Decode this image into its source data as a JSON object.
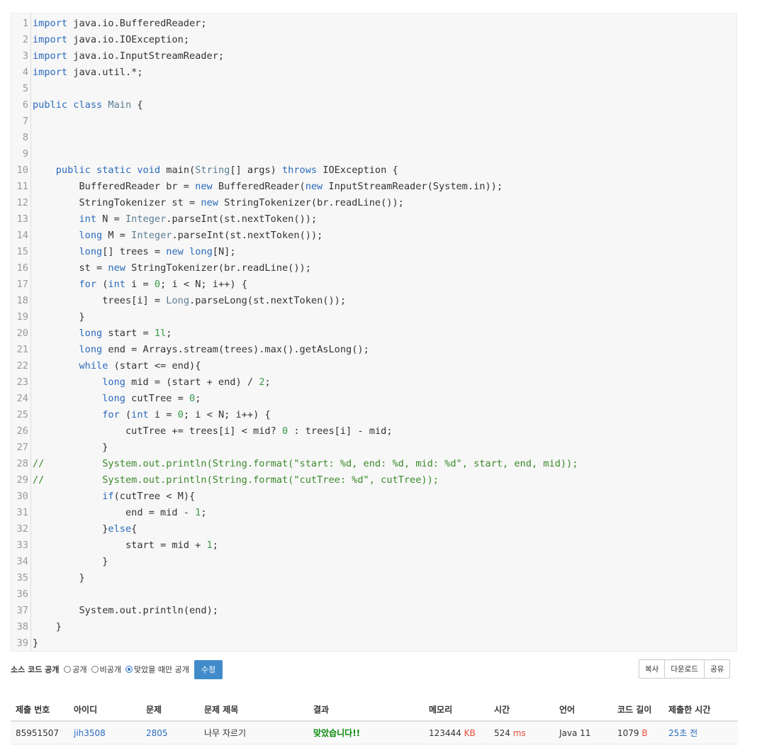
{
  "code": {
    "lines": [
      "import java.io.BufferedReader;",
      "import java.io.IOException;",
      "import java.io.InputStreamReader;",
      "import java.util.*;",
      "",
      "public class Main {",
      "",
      "",
      "",
      "    public static void main(String[] args) throws IOException {",
      "        BufferedReader br = new BufferedReader(new InputStreamReader(System.in));",
      "        StringTokenizer st = new StringTokenizer(br.readLine());",
      "        int N = Integer.parseInt(st.nextToken());",
      "        long M = Integer.parseInt(st.nextToken());",
      "        long[] trees = new long[N];",
      "        st = new StringTokenizer(br.readLine());",
      "        for (int i = 0; i < N; i++) {",
      "            trees[i] = Long.parseLong(st.nextToken());",
      "        }",
      "        long start = 1l;",
      "        long end = Arrays.stream(trees).max().getAsLong();",
      "        while (start <= end){",
      "            long mid = (start + end) / 2;",
      "            long cutTree = 0;",
      "            for (int i = 0; i < N; i++) {",
      "                cutTree += trees[i] < mid? 0 : trees[i] - mid;",
      "            }",
      "//          System.out.println(String.format(\"start: %d, end: %d, mid: %d\", start, end, mid));",
      "//          System.out.println(String.format(\"cutTree: %d\", cutTree));",
      "            if(cutTree < M){",
      "                end = mid - 1;",
      "            }else{",
      "                start = mid + 1;",
      "            }",
      "        }",
      "",
      "        System.out.println(end);",
      "    }",
      "}"
    ]
  },
  "source_visibility": {
    "label": "소스 코드 공개",
    "options": [
      "공개",
      "비공개",
      "맞았을 때만 공개"
    ],
    "selected_index": 2,
    "edit_label": "수정"
  },
  "actions": {
    "copy": "복사",
    "download": "다운로드",
    "share": "공유"
  },
  "table": {
    "headers": [
      "제출 번호",
      "아이디",
      "문제",
      "문제 제목",
      "결과",
      "메모리",
      "시간",
      "언어",
      "코드 길이",
      "제출한 시간"
    ],
    "row": {
      "submission_id": "85951507",
      "user_id": "jih3508",
      "problem_id": "2805",
      "problem_title": "나무 자르기",
      "result": "맞았습니다!!",
      "memory": "123444",
      "memory_unit": "KB",
      "time": "524",
      "time_unit": "ms",
      "language": "Java 11",
      "code_length": "1079",
      "code_length_unit": "B",
      "submitted": "25초 전"
    }
  },
  "colors": {
    "keyword": "#2a6bbd",
    "number": "#3a9a4a",
    "comment": "#3a8a2a",
    "accepted": "#0a8a0a",
    "unit": "#e74c3c",
    "button": "#428bca"
  }
}
